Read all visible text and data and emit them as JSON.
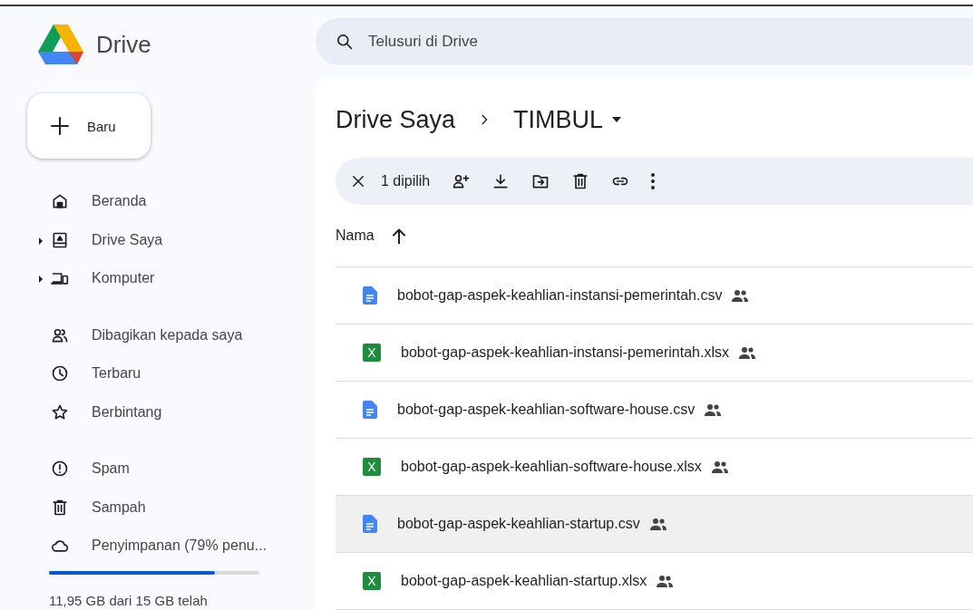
{
  "app": {
    "title": "Drive"
  },
  "search": {
    "placeholder": "Telusuri di Drive"
  },
  "new_button": {
    "label": "Baru"
  },
  "sidebar": {
    "groups": [
      [
        {
          "label": "Beranda",
          "expandable": false
        },
        {
          "label": "Drive Saya",
          "expandable": true
        },
        {
          "label": "Komputer",
          "expandable": true
        }
      ],
      [
        {
          "label": "Dibagikan kepada saya",
          "expandable": false
        },
        {
          "label": "Terbaru",
          "expandable": false
        },
        {
          "label": "Berbintang",
          "expandable": false
        }
      ],
      [
        {
          "label": "Spam",
          "expandable": false
        },
        {
          "label": "Sampah",
          "expandable": false
        },
        {
          "label": "Penyimpanan (79% penu...",
          "expandable": false
        }
      ]
    ]
  },
  "storage": {
    "level": 0.79,
    "detail": "11,95 GB dari 15 GB telah"
  },
  "breadcrumb": {
    "parent": "Drive Saya",
    "current": "TIMBUL"
  },
  "selection_bar": {
    "count": "1 dipilih"
  },
  "table": {
    "columns": [
      {
        "label": "Nama",
        "sorted_ascending": true
      }
    ],
    "rows": [
      {
        "name": "bobot-gap-aspek-keahlian-instansi-pemerintah.csv",
        "kind": "doc",
        "shared": true,
        "selected": false
      },
      {
        "name": "bobot-gap-aspek-keahlian-instansi-pemerintah.xlsx",
        "kind": "sheet",
        "icon_text": "X",
        "shared": true,
        "selected": false
      },
      {
        "name": "bobot-gap-aspek-keahlian-software-house.csv",
        "kind": "doc",
        "shared": true,
        "selected": false
      },
      {
        "name": "bobot-gap-aspek-keahlian-software-house.xlsx",
        "kind": "sheet",
        "icon_text": "X",
        "shared": true,
        "selected": false
      },
      {
        "name": "bobot-gap-aspek-keahlian-startup.csv",
        "kind": "doc",
        "shared": true,
        "selected": true
      },
      {
        "name": "bobot-gap-aspek-keahlian-startup.xlsx",
        "kind": "sheet",
        "icon_text": "X",
        "shared": true,
        "selected": false
      }
    ]
  }
}
